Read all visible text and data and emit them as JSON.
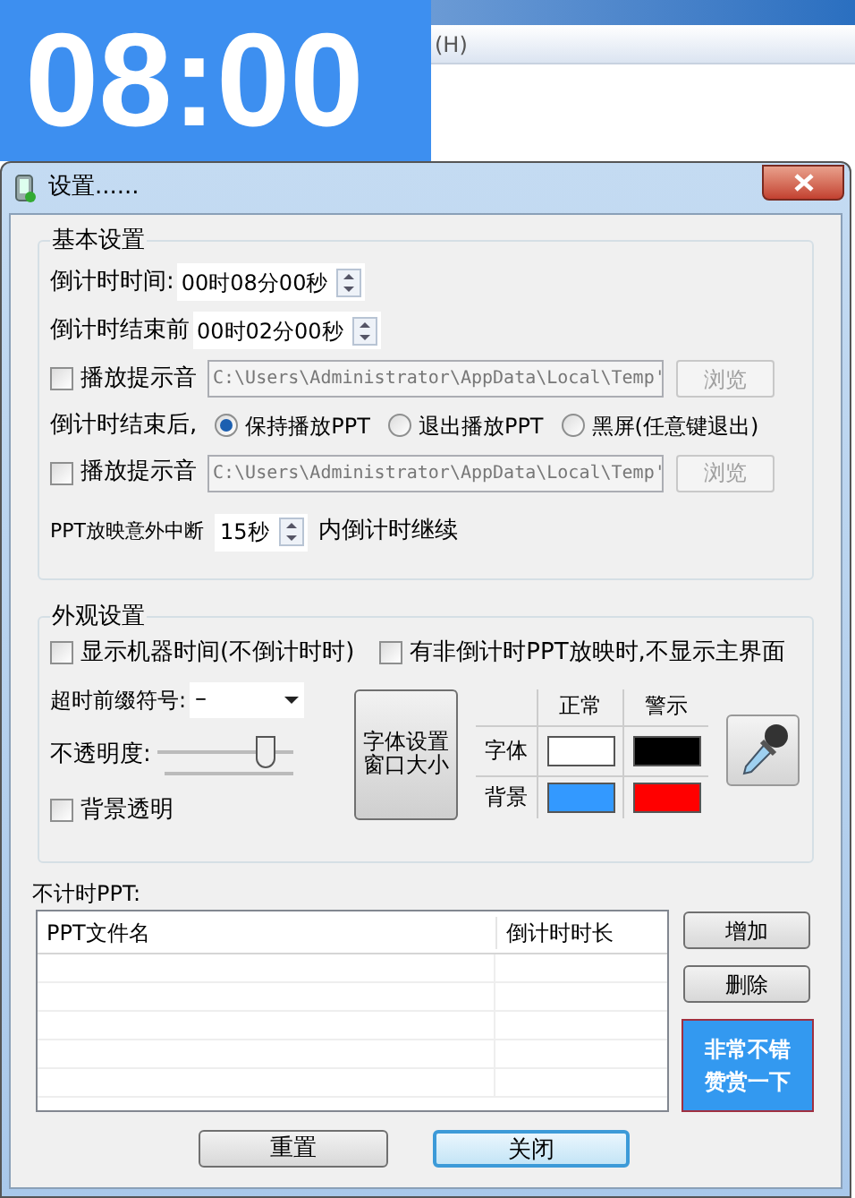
{
  "background_window": {
    "menu": [
      "(H)"
    ]
  },
  "timer": {
    "time": "08:00"
  },
  "dialog": {
    "title": "设置......",
    "basic": {
      "title": "基本设置",
      "countdown": {
        "label": "倒计时时间:",
        "value": "00时08分00秒"
      },
      "before_end": {
        "label": "倒计时结束前",
        "value": "00时02分00秒"
      },
      "sound1": {
        "label": "播放提示音",
        "checked": false,
        "path": "C:\\Users\\Administrator\\AppData\\Local\\Temp'",
        "browse": "浏览",
        "browse_disabled": true
      },
      "after_end": {
        "label": "倒计时结束后,",
        "options": [
          {
            "label": "保持播放PPT",
            "selected": true
          },
          {
            "label": "退出播放PPT",
            "selected": false
          },
          {
            "label": "黑屏(任意键退出)",
            "selected": false
          }
        ]
      },
      "sound2": {
        "label": "播放提示音",
        "checked": false,
        "path": "C:\\Users\\Administrator\\AppData\\Local\\Temp'",
        "browse": "浏览",
        "browse_disabled": true
      },
      "interrupt": {
        "label": "PPT放映意外中断",
        "value": "15秒",
        "suffix": "内倒计时继续"
      }
    },
    "appearance": {
      "title": "外观设置",
      "show_machine_time": {
        "label": "显示机器时间(不倒计时时)",
        "checked": false
      },
      "hide_main": {
        "label": "有非倒计时PPT放映时,不显示主界面",
        "checked": false
      },
      "prefix": {
        "label": "超时前缀符号:",
        "value": "–"
      },
      "opacity": {
        "label": "不透明度:",
        "level": 0.8
      },
      "transparent_bg": {
        "label": "背景透明",
        "checked": false
      },
      "font_button": [
        "字体设置",
        "窗口大小"
      ],
      "colors": {
        "columns": [
          "正常",
          "警示"
        ],
        "rows": [
          {
            "label": "字体",
            "swatches": [
              {
                "color": "#ffffff"
              },
              {
                "color": "#000000"
              }
            ]
          },
          {
            "label": "背景",
            "swatches": [
              {
                "color": "#3399ff"
              },
              {
                "color": "#ff0000"
              }
            ]
          }
        ]
      }
    },
    "untimed": {
      "title": "不计时PPT:",
      "columns": [
        "PPT文件名",
        "倒计时时长"
      ],
      "add": "增加",
      "delete": "删除",
      "donate": [
        "非常不错",
        "赞赏一下"
      ]
    },
    "buttons": [
      {
        "label": "重置",
        "default": false
      },
      {
        "label": "关闭",
        "default": true
      }
    ]
  }
}
